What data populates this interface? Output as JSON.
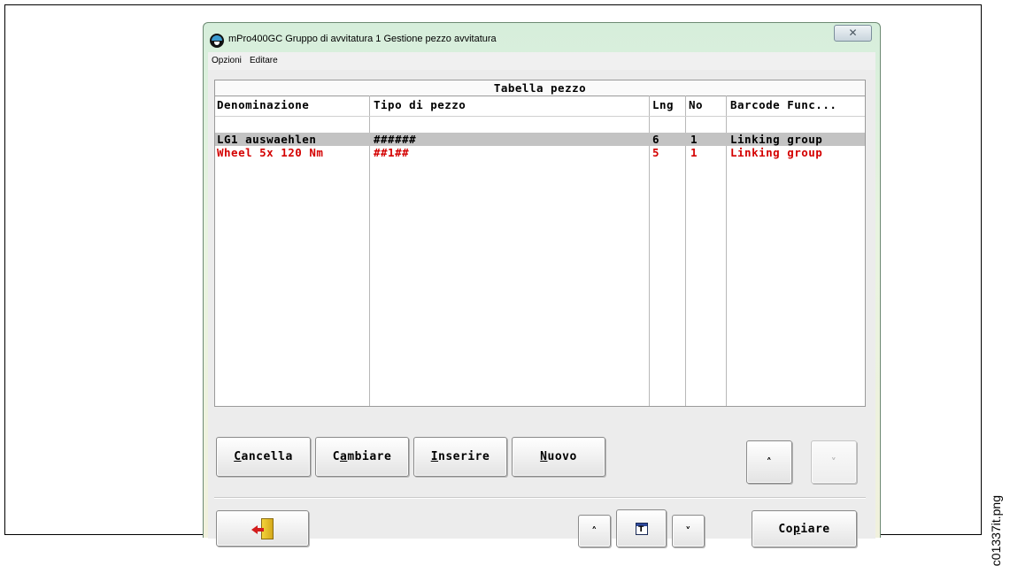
{
  "window": {
    "title": "mPro400GC Gruppo di avvitatura 1   Gestione pezzo avvitatura",
    "close_glyph": "✕"
  },
  "menu": [
    "Opzioni",
    "Editare"
  ],
  "table": {
    "title": "Tabella pezzo",
    "columns": [
      "Denominazione",
      "Tipo di pezzo",
      "Lng",
      "No",
      "Barcode Func..."
    ],
    "rows": [
      {
        "name": "LG1 auswaehlen",
        "type": "######",
        "lng": "6",
        "no": "1",
        "barcode": "Linking group",
        "selected": true,
        "color": "#000000"
      },
      {
        "name": "Wheel 5x 120 Nm",
        "type": "##1##",
        "lng": "5",
        "no": "1",
        "barcode": "Linking group",
        "selected": false,
        "color": "#d40000"
      }
    ]
  },
  "buttons": {
    "cancella": {
      "pre": "",
      "ul": "C",
      "post": "ancella"
    },
    "cambiare": {
      "pre": "C",
      "ul": "a",
      "post": "mbiare"
    },
    "inserire": {
      "pre": "",
      "ul": "I",
      "post": "nserire"
    },
    "nuovo": {
      "pre": "",
      "ul": "N",
      "post": "uovo"
    },
    "copiare": {
      "pre": "Co",
      "ul": "p",
      "post": "iare"
    },
    "up_glyph": "˄",
    "down_glyph": "˅",
    "t_glyph": "T"
  },
  "icons": {
    "exit": "exit-door-icon",
    "table": "table-t-icon",
    "app": "app-logo-icon"
  },
  "side_label": "c01337it.png"
}
